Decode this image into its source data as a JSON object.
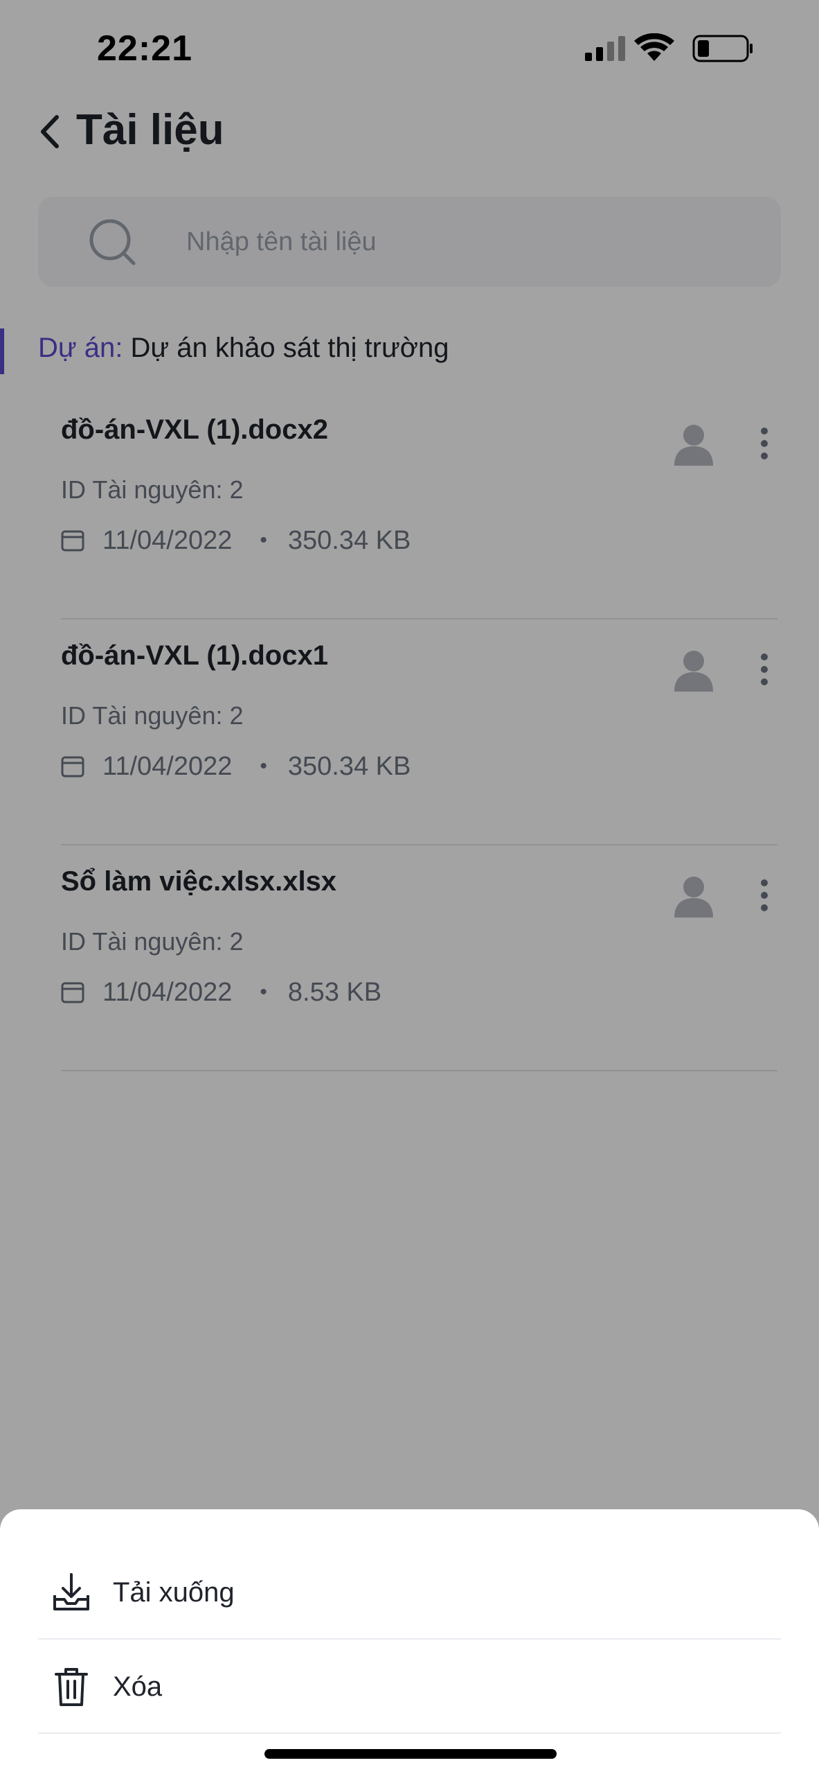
{
  "status_bar": {
    "time": "22:21"
  },
  "header": {
    "title": "Tài liệu"
  },
  "search": {
    "placeholder": "Nhập tên tài liệu"
  },
  "project": {
    "label": "Dự án:",
    "name": " Dự án khảo sát thị trường"
  },
  "documents": [
    {
      "name": "đồ-án-VXL (1).docx2",
      "id_text": "ID Tài nguyên: 2",
      "date": "11/04/2022",
      "size": "350.34 KB"
    },
    {
      "name": "đồ-án-VXL (1).docx1",
      "id_text": "ID Tài nguyên: 2",
      "date": "11/04/2022",
      "size": "350.34 KB"
    },
    {
      "name": "Sổ làm việc.xlsx.xlsx",
      "id_text": "ID Tài nguyên: 2",
      "date": "11/04/2022",
      "size": "8.53 KB"
    }
  ],
  "meta_separator": "•",
  "action_sheet": {
    "download_label": "Tải xuống",
    "delete_label": "Xóa"
  },
  "colors": {
    "accent": "#5a4ad1",
    "text": "#1f232b",
    "muted": "#6d7380",
    "overlay": "rgba(0,0,0,0.36)"
  },
  "icons": {
    "back": "chevron-left-icon",
    "search": "search-icon",
    "calendar": "calendar-icon",
    "avatar": "user-avatar-icon",
    "more": "more-vertical-icon",
    "download": "download-icon",
    "delete": "trash-icon"
  }
}
